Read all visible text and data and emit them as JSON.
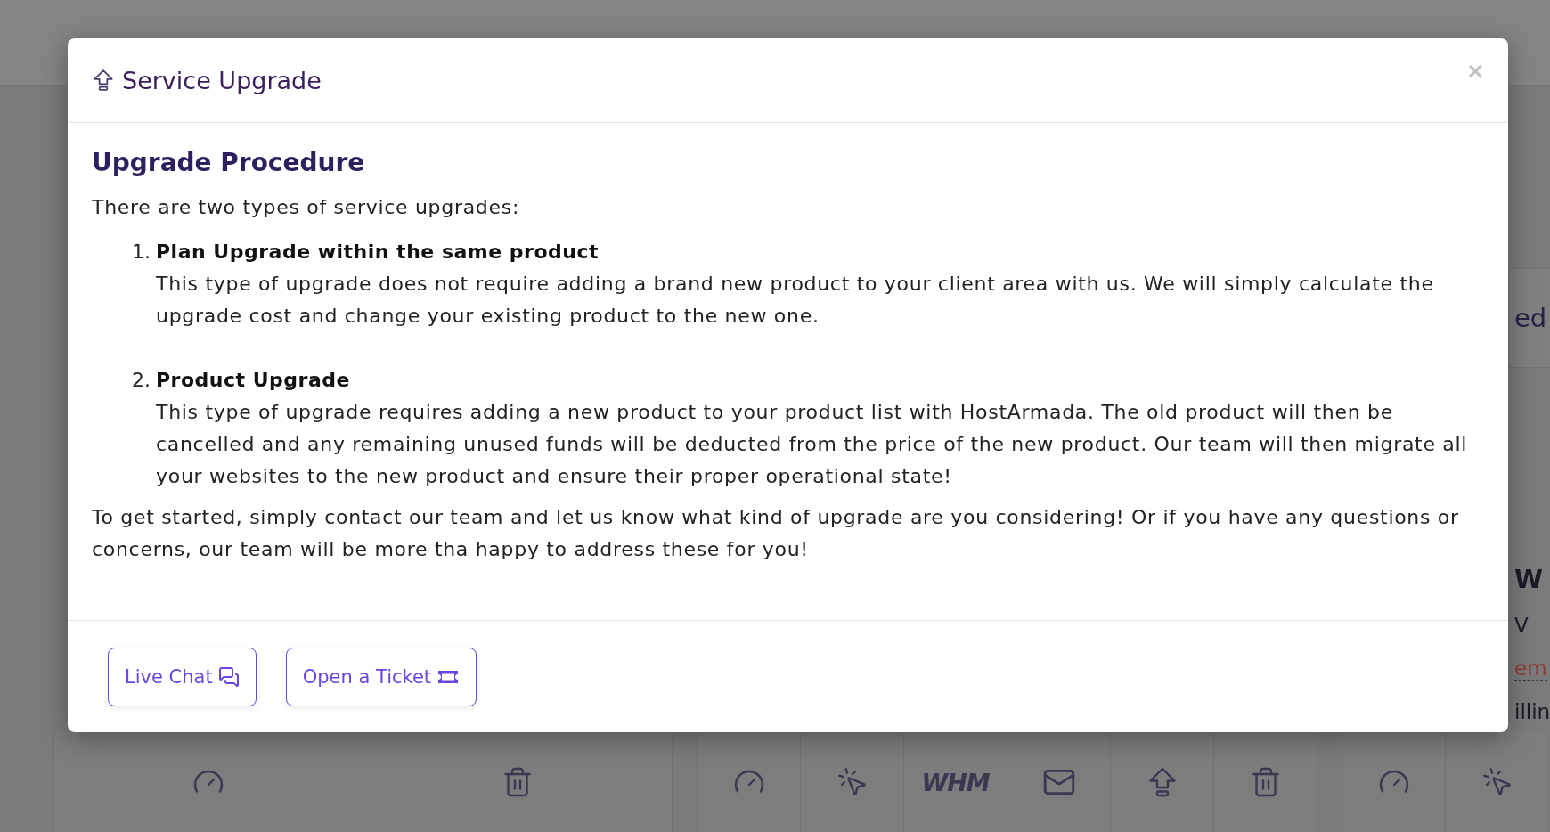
{
  "background": {
    "side_texts": [
      {
        "kind": "heading",
        "text": "ed"
      },
      {
        "kind": "bold",
        "text": "W"
      },
      {
        "kind": "plain",
        "text": "V"
      },
      {
        "kind": "link",
        "text": "em"
      },
      {
        "kind": "plain",
        "text": "illin"
      }
    ],
    "tile_groups": [
      {
        "tiles": [
          {
            "kind": "gauge"
          },
          {
            "kind": "trash"
          }
        ]
      },
      {
        "tiles": [
          {
            "kind": "gauge"
          },
          {
            "kind": "pointer"
          },
          {
            "kind": "logo",
            "text": "WHM"
          },
          {
            "kind": "mail"
          },
          {
            "kind": "upgrade"
          },
          {
            "kind": "trash"
          }
        ]
      },
      {
        "tiles": [
          {
            "kind": "gauge"
          },
          {
            "kind": "pointer"
          }
        ]
      }
    ]
  },
  "modal": {
    "title": "Service Upgrade",
    "close": "×",
    "heading": "Upgrade Procedure",
    "intro": "There are two types of service upgrades:",
    "steps": [
      {
        "number": "1.",
        "title": "Plan Upgrade within the same product",
        "text": "This type of upgrade does not require adding a brand new product to your client area with us. We will simply calculate the upgrade cost and change your existing product to the new one."
      },
      {
        "number": "2.",
        "title": "Product Upgrade",
        "text": "This type of upgrade requires adding a new product to your product list with HostArmada. The old product will then be cancelled and any remaining unused funds will be deducted from the price of the new product. Our team will then migrate all your websites to the new product and ensure their proper operational state!"
      }
    ],
    "outro": "To get started, simply contact our team and let us know what kind of upgrade are you considering! Or if you have any questions or concerns, our team will be more tha happy to address these for you!",
    "buttons": [
      {
        "kind": "chat",
        "label": "Live Chat"
      },
      {
        "kind": "ticket",
        "label": "Open a Ticket"
      }
    ]
  }
}
